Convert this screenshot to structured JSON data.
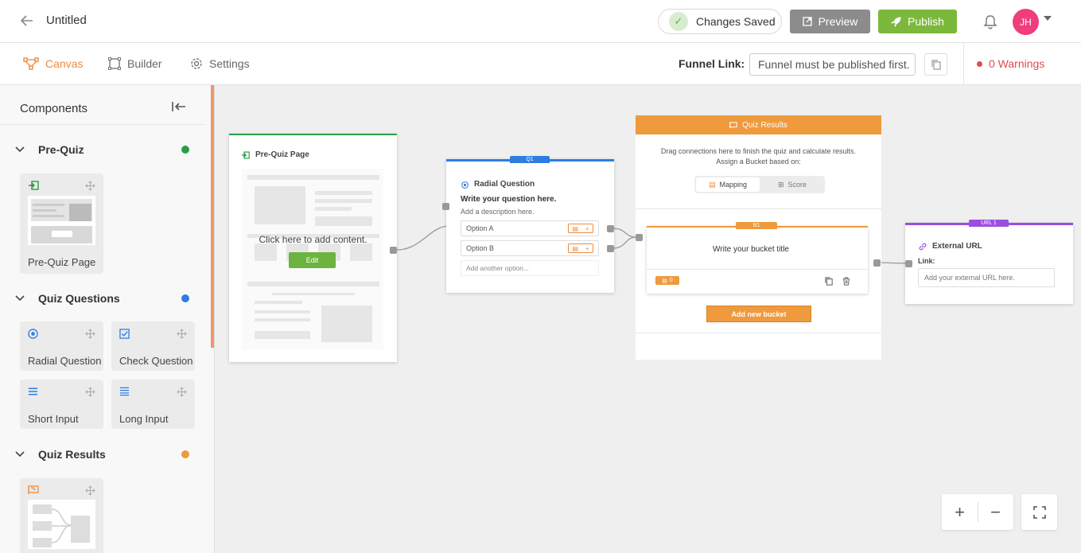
{
  "header": {
    "title": "Untitled",
    "saved_label": "Changes Saved",
    "preview_label": "Preview",
    "publish_label": "Publish",
    "avatar_initials": "JH"
  },
  "subbar": {
    "tabs": [
      {
        "label": "Canvas",
        "active": true
      },
      {
        "label": "Builder",
        "active": false
      },
      {
        "label": "Settings",
        "active": false
      }
    ],
    "funnel_link_label": "Funnel Link:",
    "funnel_link_value": "Funnel must be published first.",
    "warnings_label": "0 Warnings"
  },
  "sidebar": {
    "title": "Components",
    "sections": [
      {
        "label": "Pre-Quiz",
        "color": "#2a9d4b",
        "items": [
          "Pre-Quiz Page"
        ]
      },
      {
        "label": "Quiz Questions",
        "color": "#2f7de1",
        "items": [
          "Radial Question",
          "Check Question",
          "Short Input",
          "Long Input"
        ]
      },
      {
        "label": "Quiz Results",
        "color": "#ef9a3d",
        "items": [
          ""
        ]
      }
    ]
  },
  "canvas": {
    "prequiz": {
      "title": "Pre-Quiz Page",
      "placeholder": "Click here to add content.",
      "edit_label": "Edit"
    },
    "question": {
      "tag": "Q1",
      "type_label": "Radial Question",
      "question_text": "Write your question here.",
      "description": "Add a description here.",
      "options": [
        "Option A",
        "Option B"
      ],
      "add_option": "Add another option..."
    },
    "results": {
      "title": "Quiz Results",
      "instructions_line1": "Drag connections here to finish the quiz and calculate results.",
      "instructions_line2": "Assign a Bucket based on:",
      "mode_mapping": "Mapping",
      "mode_score": "Score",
      "bucket_tag": "B1",
      "bucket_title": "Write your bucket title",
      "bucket_count": "0",
      "add_bucket_label": "Add new bucket"
    },
    "external": {
      "tag": "URL 1",
      "title": "External URL",
      "link_label": "Link:",
      "placeholder": "Add your external URL here."
    }
  },
  "colors": {
    "accent": "#ef8c3d",
    "publish": "#7cb83c",
    "preview": "#8c8c8c",
    "warning": "#e24a4a",
    "question_blue": "#2f7de1",
    "url_purple": "#9b4fe0",
    "prequiz_green": "#2a9d4b"
  }
}
